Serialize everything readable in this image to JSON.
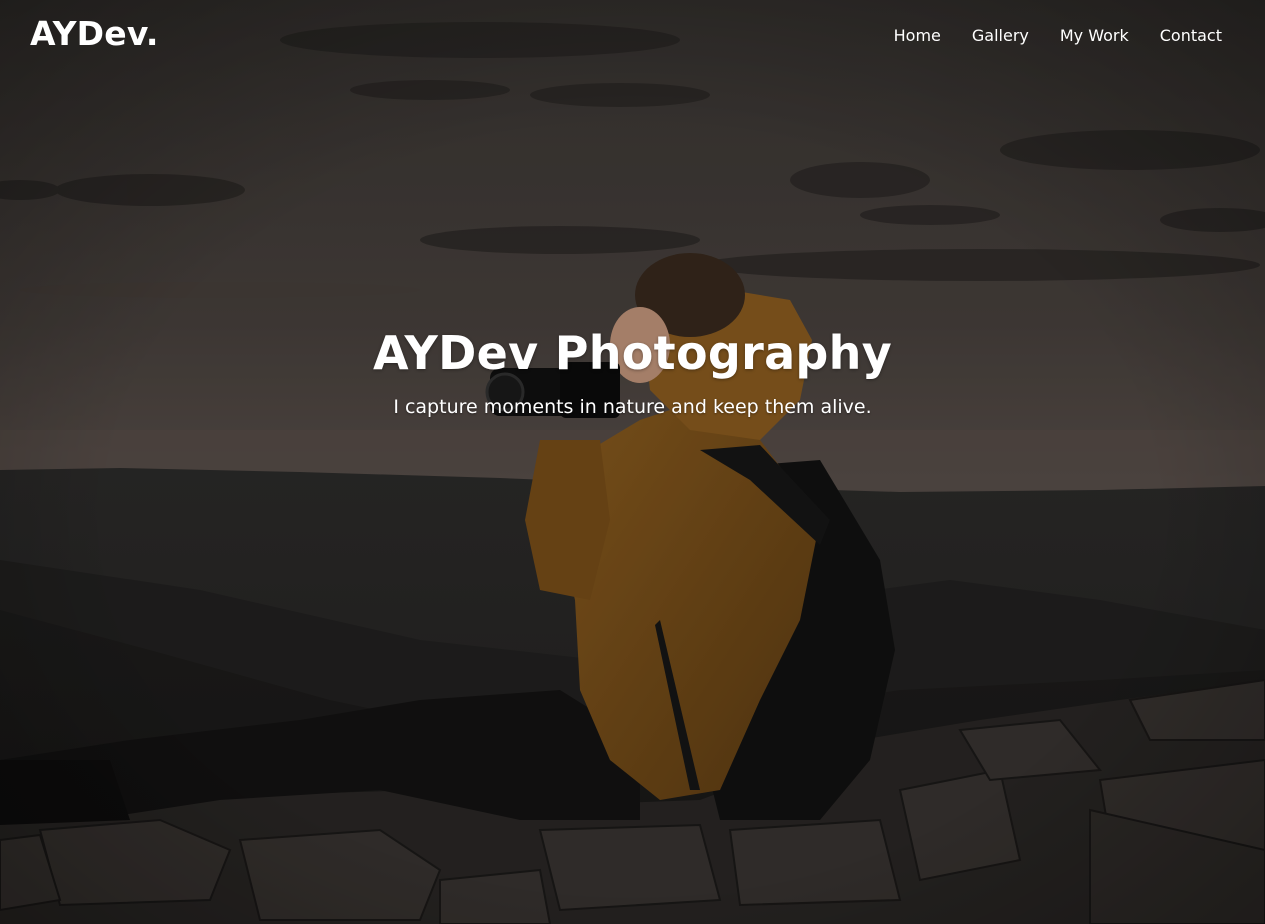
{
  "navbar": {
    "brand": "AYDev.",
    "links": [
      {
        "label": "Home"
      },
      {
        "label": "Gallery"
      },
      {
        "label": "My Work"
      },
      {
        "label": "Contact"
      }
    ]
  },
  "hero": {
    "title": "AYDev Photography",
    "subtitle": "I capture moments in nature and keep them alive.",
    "background_image": "photographer-on-mountain-at-dusk",
    "overlay_color": "#000000"
  },
  "colors": {
    "text": "#ffffff",
    "jacket": "#8a5a1c",
    "sky": "#4a4440"
  }
}
